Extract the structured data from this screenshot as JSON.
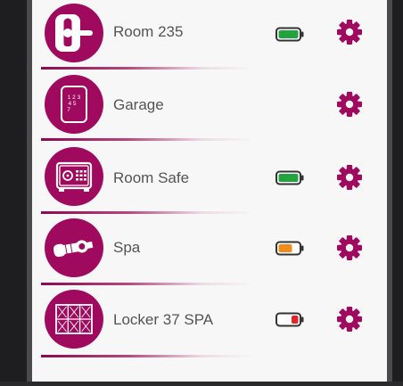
{
  "devices": [
    {
      "name": "Room 235",
      "icon": "door-handle-icon",
      "battery": "full",
      "battery_color": "#23a33f"
    },
    {
      "name": "Garage",
      "icon": "keypad-icon",
      "battery": null,
      "battery_color": null
    },
    {
      "name": "Room Safe",
      "icon": "safe-icon",
      "battery": "full",
      "battery_color": "#23a33f"
    },
    {
      "name": "Spa",
      "icon": "lock-cylinder-icon",
      "battery": "medium",
      "battery_color": "#f08c1c"
    },
    {
      "name": "Locker 37 SPA",
      "icon": "lockers-icon",
      "battery": "low",
      "battery_color": "#e2252b"
    }
  ],
  "colors": {
    "accent": "#a00a5e",
    "label": "#545454",
    "background": "#f8f7f7"
  },
  "settings_icon": "gear-icon",
  "keypad_digits": [
    "1 2 3",
    "4 5",
    "7"
  ]
}
